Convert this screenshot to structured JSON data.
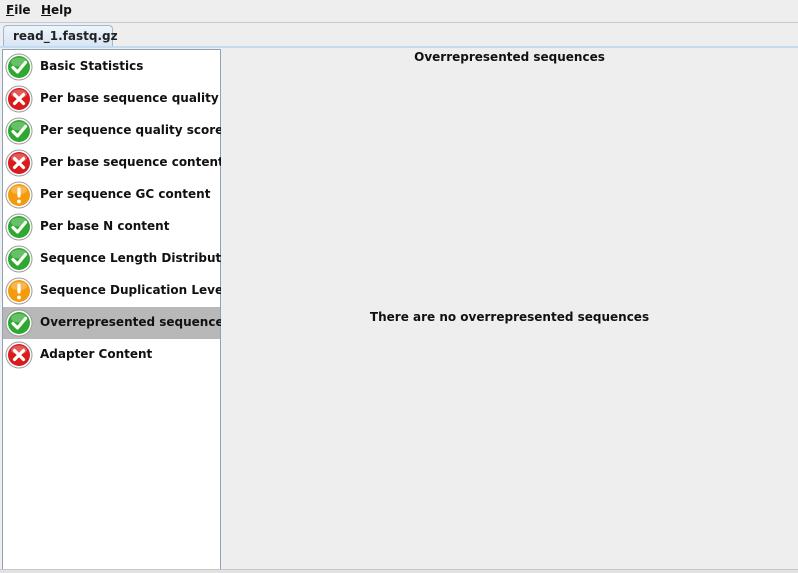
{
  "menu": {
    "file": {
      "mnemonic": "F",
      "rest": "ile"
    },
    "help": {
      "mnemonic": "H",
      "rest": "elp"
    }
  },
  "tabs": [
    {
      "label": "read_1.fastq.gz",
      "active": true
    }
  ],
  "modules": [
    {
      "label": "Basic Statistics",
      "status": "pass",
      "icon": "pass-icon"
    },
    {
      "label": "Per base sequence quality",
      "status": "fail",
      "icon": "fail-icon"
    },
    {
      "label": "Per sequence quality scores",
      "status": "pass",
      "icon": "pass-icon"
    },
    {
      "label": "Per base sequence content",
      "status": "fail",
      "icon": "fail-icon"
    },
    {
      "label": "Per sequence GC content",
      "status": "warn",
      "icon": "warn-icon"
    },
    {
      "label": "Per base N content",
      "status": "pass",
      "icon": "pass-icon"
    },
    {
      "label": "Sequence Length Distribution",
      "status": "pass",
      "icon": "pass-icon"
    },
    {
      "label": "Sequence Duplication Levels",
      "status": "warn",
      "icon": "warn-icon"
    },
    {
      "label": "Overrepresented sequences",
      "status": "pass",
      "icon": "pass-icon",
      "selected": true
    },
    {
      "label": "Adapter Content",
      "status": "fail",
      "icon": "fail-icon"
    }
  ],
  "result": {
    "title": "Overrepresented sequences",
    "message": "There are no overrepresented sequences"
  },
  "colors": {
    "pass": "#2ea82e",
    "fail": "#d81c1c",
    "warn": "#f59a0a",
    "selected_row": "#b8b8b8",
    "tab_border": "#9db8d6"
  }
}
